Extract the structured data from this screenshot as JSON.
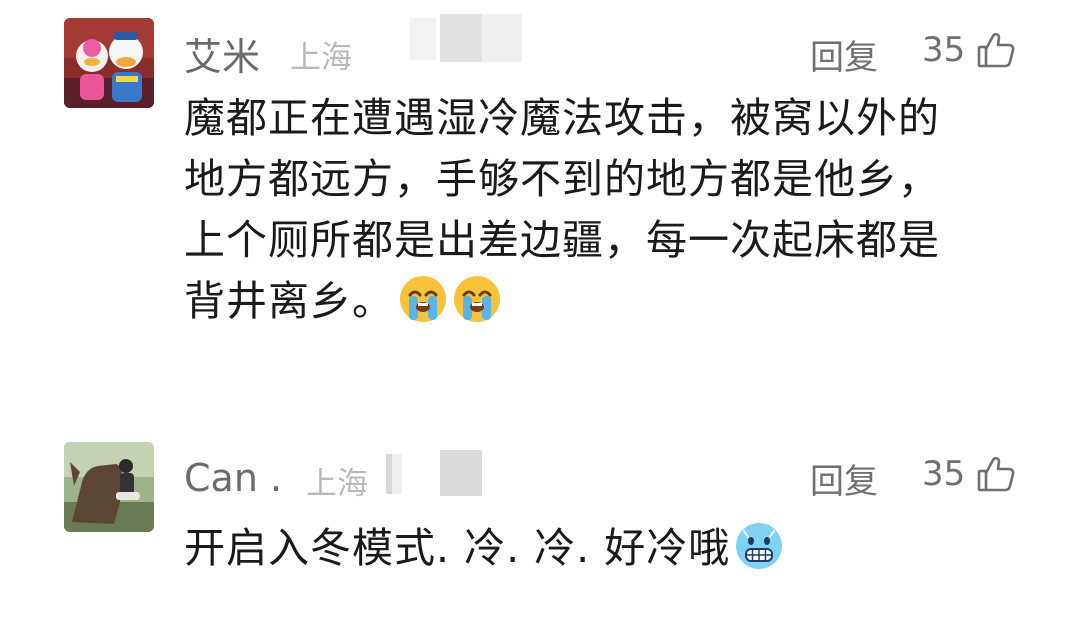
{
  "comments": [
    {
      "username": "艾米",
      "location": "上海",
      "reply_label": "回复",
      "likes": "35",
      "lines": [
        "魔都正在遭遇湿冷魔法攻击，被窝以外的",
        "地方都远方，手够不到的地方都是他乡，",
        "上个厕所都是出差边疆，每一次起床都是",
        "背井离乡。"
      ],
      "trailing_emojis": [
        "crying-emoji",
        "crying-emoji"
      ]
    },
    {
      "username": "Can .",
      "location": "上海",
      "reply_label": "回复",
      "likes": "35",
      "lines": [
        "开启入冬模式. 冷. 冷. 好冷哦"
      ],
      "trailing_emojis": [
        "freezing-emoji"
      ]
    }
  ],
  "icons": {
    "like": "thumbs-up-icon",
    "crying": "loudly-crying-face",
    "cold": "cold-face"
  },
  "colors": {
    "username": "#6b6b6b",
    "location": "#b9b9b9",
    "meta": "#707070",
    "text": "#1a1a1a",
    "emoji_yellow": "#f6c23a",
    "emoji_blue": "#7fd2f0"
  }
}
